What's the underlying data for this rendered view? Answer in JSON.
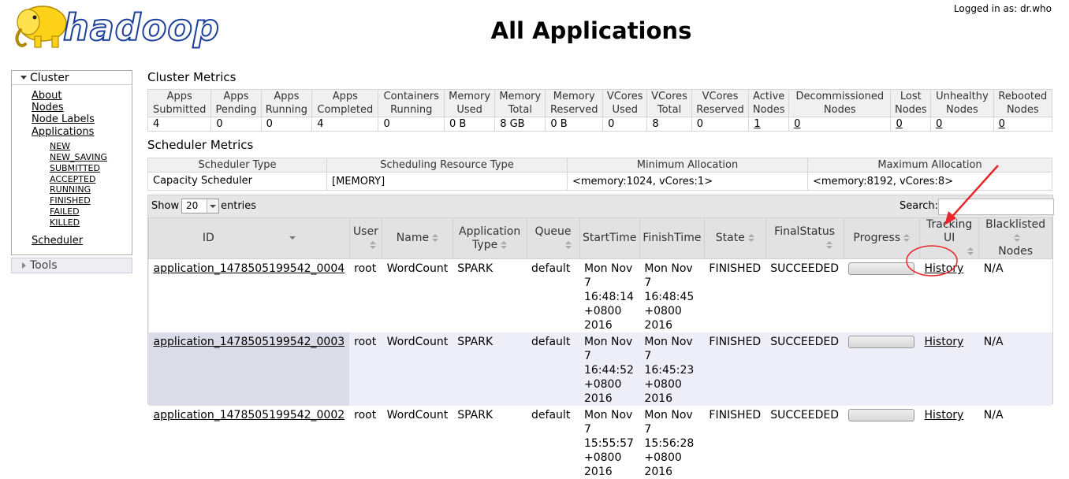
{
  "header": {
    "logo_text": "hadoop",
    "page_title": "All Applications",
    "logged_in": "Logged in as: dr.who"
  },
  "sidebar": {
    "cluster_label": "Cluster",
    "links": [
      "About",
      "Nodes",
      "Node Labels",
      "Applications"
    ],
    "app_states": [
      "NEW",
      "NEW_SAVING",
      "SUBMITTED",
      "ACCEPTED",
      "RUNNING",
      "FINISHED",
      "FAILED",
      "KILLED"
    ],
    "scheduler": "Scheduler",
    "tools_label": "Tools"
  },
  "cluster_metrics": {
    "heading": "Cluster Metrics",
    "headers": [
      [
        "Apps",
        "Submitted"
      ],
      [
        "Apps",
        "Pending"
      ],
      [
        "Apps",
        "Running"
      ],
      [
        "Apps",
        "Completed"
      ],
      [
        "Containers",
        "Running"
      ],
      [
        "Memory",
        "Used"
      ],
      [
        "Memory",
        "Total"
      ],
      [
        "Memory",
        "Reserved"
      ],
      [
        "VCores",
        "Used"
      ],
      [
        "VCores",
        "Total"
      ],
      [
        "VCores",
        "Reserved"
      ],
      [
        "Active",
        "Nodes"
      ],
      [
        "Decommissioned",
        "Nodes"
      ],
      [
        "Lost",
        "Nodes"
      ],
      [
        "Unhealthy",
        "Nodes"
      ],
      [
        "Rebooted",
        "Nodes"
      ]
    ],
    "values": [
      "4",
      "0",
      "0",
      "4",
      "0",
      "0 B",
      "8 GB",
      "0 B",
      "0",
      "8",
      "0",
      "1",
      "0",
      "0",
      "0",
      "0"
    ]
  },
  "scheduler_metrics": {
    "heading": "Scheduler Metrics",
    "headers": [
      "Scheduler Type",
      "Scheduling Resource Type",
      "Minimum Allocation",
      "Maximum Allocation"
    ],
    "values": [
      "Capacity Scheduler",
      "[MEMORY]",
      "<memory:1024, vCores:1>",
      "<memory:8192, vCores:8>"
    ]
  },
  "apps_table": {
    "show_label": "Show",
    "page_size": "20",
    "entries_label": "entries",
    "search_label": "Search:",
    "headers": {
      "id": "ID",
      "user": [
        "User",
        ""
      ],
      "name": "Name",
      "app_type": [
        "Application",
        "Type"
      ],
      "queue": "Queue",
      "start": "StartTime",
      "finish": "FinishTime",
      "state": "State",
      "final": "FinalStatus",
      "progress": "Progress",
      "tracking": "Tracking UI",
      "blacklisted": [
        "Blacklisted",
        "Nodes"
      ]
    },
    "rows": [
      {
        "id": "application_1478505199542_0004",
        "user": "root",
        "name": "WordCount",
        "type": "SPARK",
        "queue": "default",
        "start": [
          "Mon Nov",
          "7 16:48:14",
          "+0800",
          "2016"
        ],
        "finish": [
          "Mon Nov 7",
          "16:48:45",
          "+0800 2016"
        ],
        "state": "FINISHED",
        "final": "SUCCEEDED",
        "progress": 1.0,
        "tracking": "History",
        "blacklisted": "N/A"
      },
      {
        "id": "application_1478505199542_0003",
        "user": "root",
        "name": "WordCount",
        "type": "SPARK",
        "queue": "default",
        "start": [
          "Mon Nov",
          "7 16:44:52",
          "+0800",
          "2016"
        ],
        "finish": [
          "Mon Nov 7",
          "16:45:23",
          "+0800 2016"
        ],
        "state": "FINISHED",
        "final": "SUCCEEDED",
        "progress": 1.0,
        "tracking": "History",
        "blacklisted": "N/A"
      },
      {
        "id": "application_1478505199542_0002",
        "user": "root",
        "name": "WordCount",
        "type": "SPARK",
        "queue": "default",
        "start": [
          "Mon Nov",
          "7 15:55:57",
          "+0800",
          "2016"
        ],
        "finish": [
          "Mon Nov 7",
          "15:56:28",
          "+0800 2016"
        ],
        "state": "FINISHED",
        "final": "SUCCEEDED",
        "progress": 1.0,
        "tracking": "History",
        "blacklisted": "N/A"
      }
    ]
  },
  "colors": {
    "annotation": "#e8262b",
    "logo_blue": "#1d3f9c",
    "elephant": "#ffd21a"
  }
}
